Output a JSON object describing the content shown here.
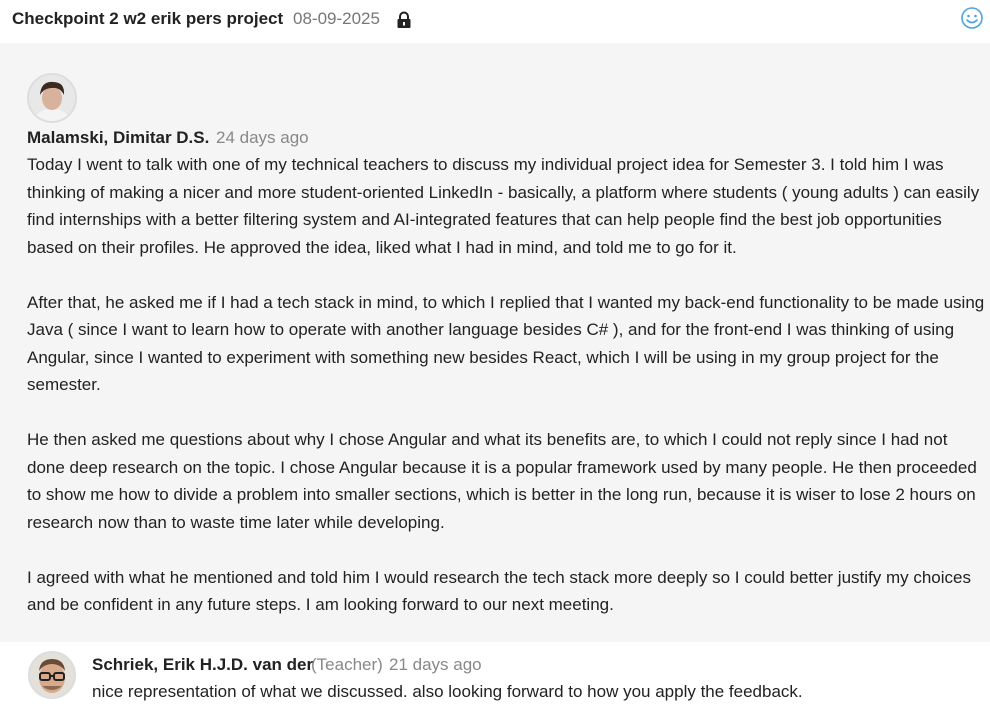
{
  "header": {
    "title": "Checkpoint 2  w2 erik pers project",
    "date": "08-09-2025",
    "lock_icon": "lock-icon",
    "reaction_icon": "smiley-icon",
    "accent_color": "#4aa3df"
  },
  "post": {
    "author": "Malamski, Dimitar D.S.",
    "time": "24 days ago",
    "paragraphs": [
      "Today I went to talk with one of my technical teachers to discuss my individual project idea for Semester 3. I told him I was thinking of making a nicer and more student-oriented LinkedIn - basically, a platform where students ( young adults ) can easily find internships with a better filtering system and AI-integrated features that can help people find the best job opportunities based on their profiles. He approved the idea, liked what I had in mind, and told me to go for it.",
      "After that, he asked me if I had a tech stack in mind, to which I replied that I wanted my back-end functionality to be made using Java ( since I want to learn how to operate with another language besides C# ), and for the front-end I was thinking of using Angular, since I wanted to experiment with something new besides React, which I will be using in my group project for the semester.",
      "He then asked me questions about why I chose Angular and what its benefits are, to which I could not reply since I had not done deep research on the topic. I chose Angular because it is a popular framework used by many people. He then proceeded to show me how to divide a problem into smaller sections, which is better in the long run, because it is wiser to lose 2 hours on research now than to waste time later while developing.",
      "I agreed with what he mentioned and told him I would research the tech stack more deeply so I could better justify my choices and be confident in any future steps. I am looking forward to our next meeting."
    ]
  },
  "reply": {
    "author": "Schriek, Erik H.J.D. van der",
    "role": "(Teacher)",
    "time": "21 days ago",
    "text": "nice representation of what we discussed. also looking forward to how you apply the feedback."
  }
}
